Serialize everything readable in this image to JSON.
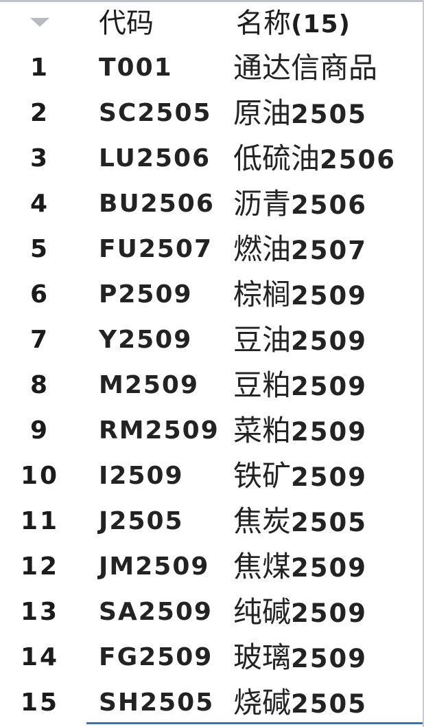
{
  "list": {
    "header": {
      "code_label": "代码",
      "name_label": "名称",
      "count_label": "(15)",
      "sort_icon": "sort-triangle-down-icon"
    },
    "rows": [
      {
        "index": "1",
        "code": "T001",
        "name": "通达信商品",
        "suffix": ""
      },
      {
        "index": "2",
        "code": "SC2505",
        "name": "原油",
        "suffix": "2505"
      },
      {
        "index": "3",
        "code": "LU2506",
        "name": "低硫油",
        "suffix": "2506"
      },
      {
        "index": "4",
        "code": "BU2506",
        "name": "沥青",
        "suffix": "2506"
      },
      {
        "index": "5",
        "code": "FU2507",
        "name": "燃油",
        "suffix": "2507"
      },
      {
        "index": "6",
        "code": "P2509",
        "name": "棕榈",
        "suffix": "2509"
      },
      {
        "index": "7",
        "code": "Y2509",
        "name": "豆油",
        "suffix": "2509"
      },
      {
        "index": "8",
        "code": "M2509",
        "name": "豆粕",
        "suffix": "2509"
      },
      {
        "index": "9",
        "code": "RM2509",
        "name": "菜粕",
        "suffix": "2509"
      },
      {
        "index": "10",
        "code": "I2509",
        "name": "铁矿",
        "suffix": "2509"
      },
      {
        "index": "11",
        "code": "J2505",
        "name": "焦炭",
        "suffix": "2505"
      },
      {
        "index": "12",
        "code": "JM2509",
        "name": "焦煤",
        "suffix": "2509"
      },
      {
        "index": "13",
        "code": "SA2509",
        "name": "纯碱",
        "suffix": "2509"
      },
      {
        "index": "14",
        "code": "FG2509",
        "name": "玻璃",
        "suffix": "2509"
      },
      {
        "index": "15",
        "code": "SH2505",
        "name": "烧碱",
        "suffix": "2505"
      }
    ]
  },
  "colors": {
    "background": "#ffffff",
    "text": "#232323",
    "accent_line": "#2b78c2",
    "sort_icon": "#b8bcc2"
  }
}
